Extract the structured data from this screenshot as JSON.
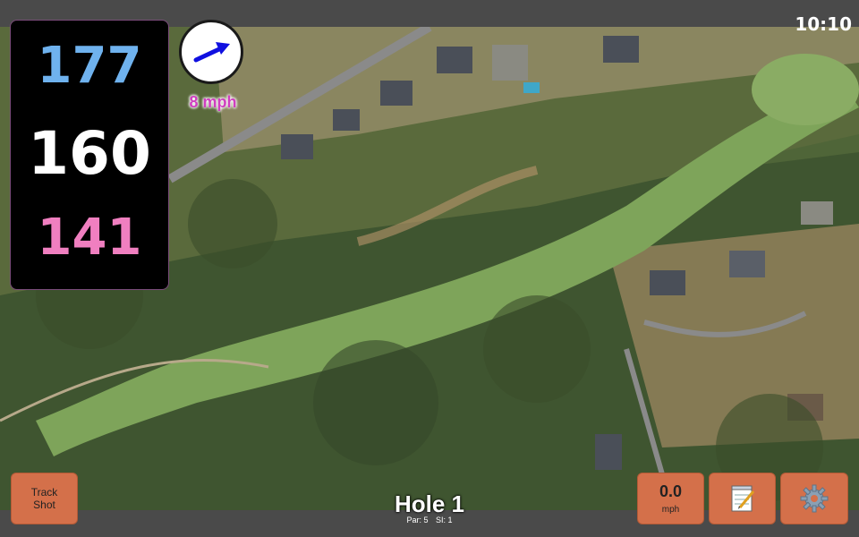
{
  "status_bar": {
    "time": "10:10"
  },
  "distances": {
    "back": "177",
    "middle": "160",
    "front": "141"
  },
  "wind": {
    "speed_label": "8 mph",
    "arrow_icon": "wind-arrow-icon",
    "arrow_color": "#1010e0"
  },
  "hole": {
    "title": "Hole 1",
    "par": "Par: 5",
    "si": "SI: 1"
  },
  "buttons": {
    "track_shot_line1": "Track",
    "track_shot_line2": "Shot",
    "speed_value": "0.0",
    "speed_unit": "mph",
    "notes_icon": "notepad-icon",
    "settings_icon": "gear-icon"
  },
  "colors": {
    "button_bg": "#d4704a",
    "back_distance": "#6fb2ee",
    "middle_distance": "#ffffff",
    "front_distance": "#f07fc0",
    "wind_label": "#d03fc0"
  }
}
